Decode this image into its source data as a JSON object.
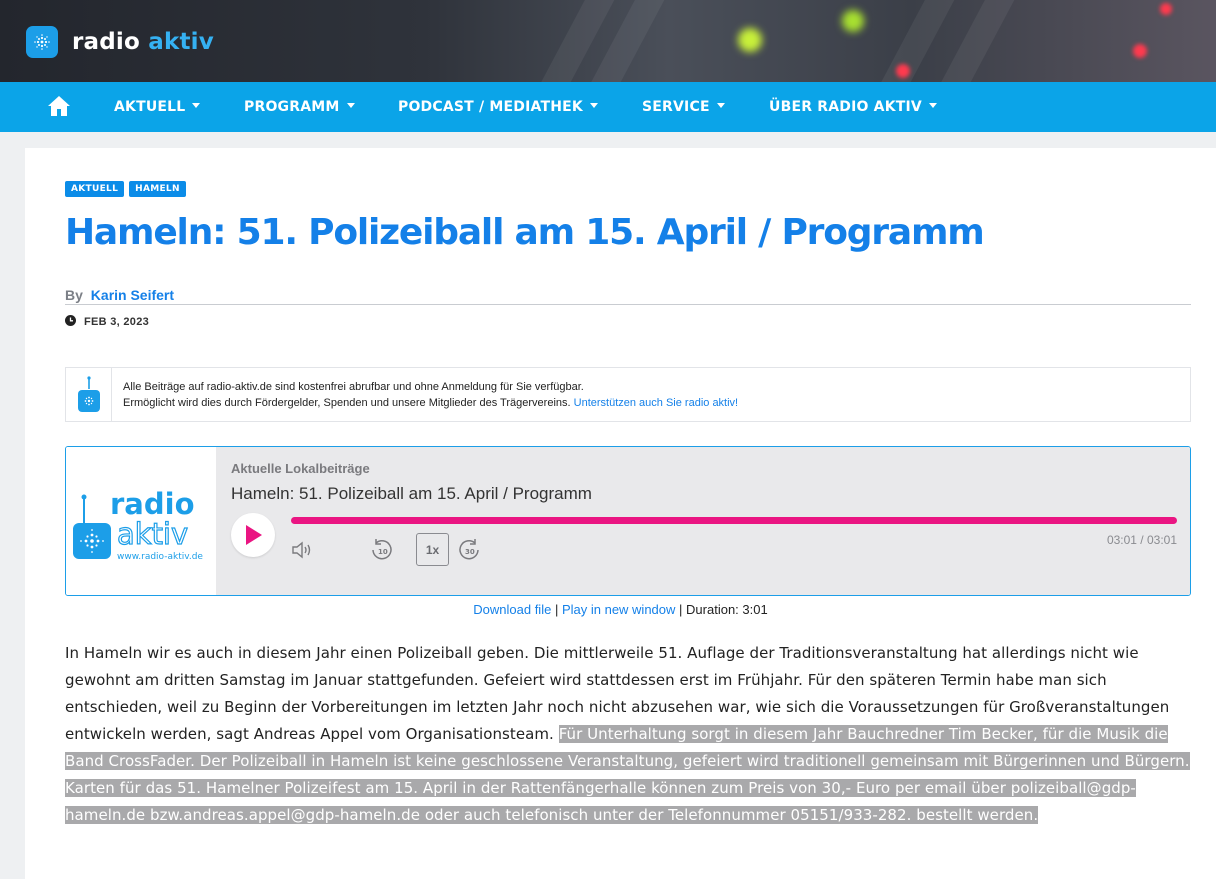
{
  "site": {
    "name_prefix": "radio",
    "name_suffix": "aktiv"
  },
  "nav": {
    "home_label": "Home",
    "items": [
      {
        "label": "AKTUELL"
      },
      {
        "label": "PROGRAMM"
      },
      {
        "label": "PODCAST / MEDIATHEK"
      },
      {
        "label": "SERVICE"
      },
      {
        "label": "ÜBER RADIO AKTIV"
      }
    ]
  },
  "article": {
    "tags": [
      "AKTUELL",
      "HAMELN"
    ],
    "title": "Hameln: 51. Polizeiball am 15. April / Programm",
    "by_label": "By",
    "author": "Karin Seifert",
    "date": "FEB 3, 2023",
    "body_plain": "In Hameln wir es auch in diesem Jahr einen Polizeiball geben. Die mittlerweile 51. Auflage der Traditionsveranstaltung hat allerdings nicht wie gewohnt am dritten Samstag im Januar stattgefunden. Gefeiert wird stattdessen erst im Frühjahr. Für den späteren Termin habe man sich entschieden, weil zu Beginn der Vorbereitungen im letzten Jahr noch nicht abzusehen war, wie sich die Voraussetzungen für Großveranstaltungen entwickeln werden, sagt Andreas Appel vom Organisationsteam. ",
    "body_selected": "Für Unterhaltung sorgt in diesem Jahr Bauchredner Tim Becker, für die Musik die Band CrossFader. Der Polizeiball in Hameln ist keine geschlossene Veranstaltung, gefeiert wird traditionell gemeinsam mit Bürgerinnen und Bürgern. Karten für das 51. Hamelner Polizeifest am 15. April in der Rattenfängerhalle können zum Preis von 30,- Euro per email über polizeiball@gdp-hameln.de bzw.andreas.appel@gdp-hameln.de oder auch telefonisch unter der Telefonnummer 05151/933-282. bestellt werden."
  },
  "notice": {
    "line1": "Alle Beiträge auf radio-aktiv.de sind kostenfrei abrufbar und ohne Anmeldung für Sie verfügbar.",
    "line2": "Ermöglicht wird dies durch Fördergelder, Spenden und unsere Mitglieder des Trägervereins.",
    "link": "Unterstützen auch Sie radio aktiv!"
  },
  "player": {
    "art_line1": "radio",
    "art_line2": "aktiv",
    "art_url": "www.radio-aktiv.de",
    "show": "Aktuelle Lokalbeiträge",
    "episode": "Hameln: 51. Polizeiball am 15. April / Programm",
    "speed": "1x",
    "rewind_seconds": "10",
    "forward_seconds": "30",
    "time": "03:01 / 03:01",
    "progress": 1.0,
    "download_label": "Download file",
    "new_window_label": "Play in new window",
    "separator": "|",
    "duration_label": "Duration: 3:01"
  },
  "colors": {
    "accent": "#1480e8",
    "nav": "#0ba4e8",
    "progress": "#ea1582"
  }
}
